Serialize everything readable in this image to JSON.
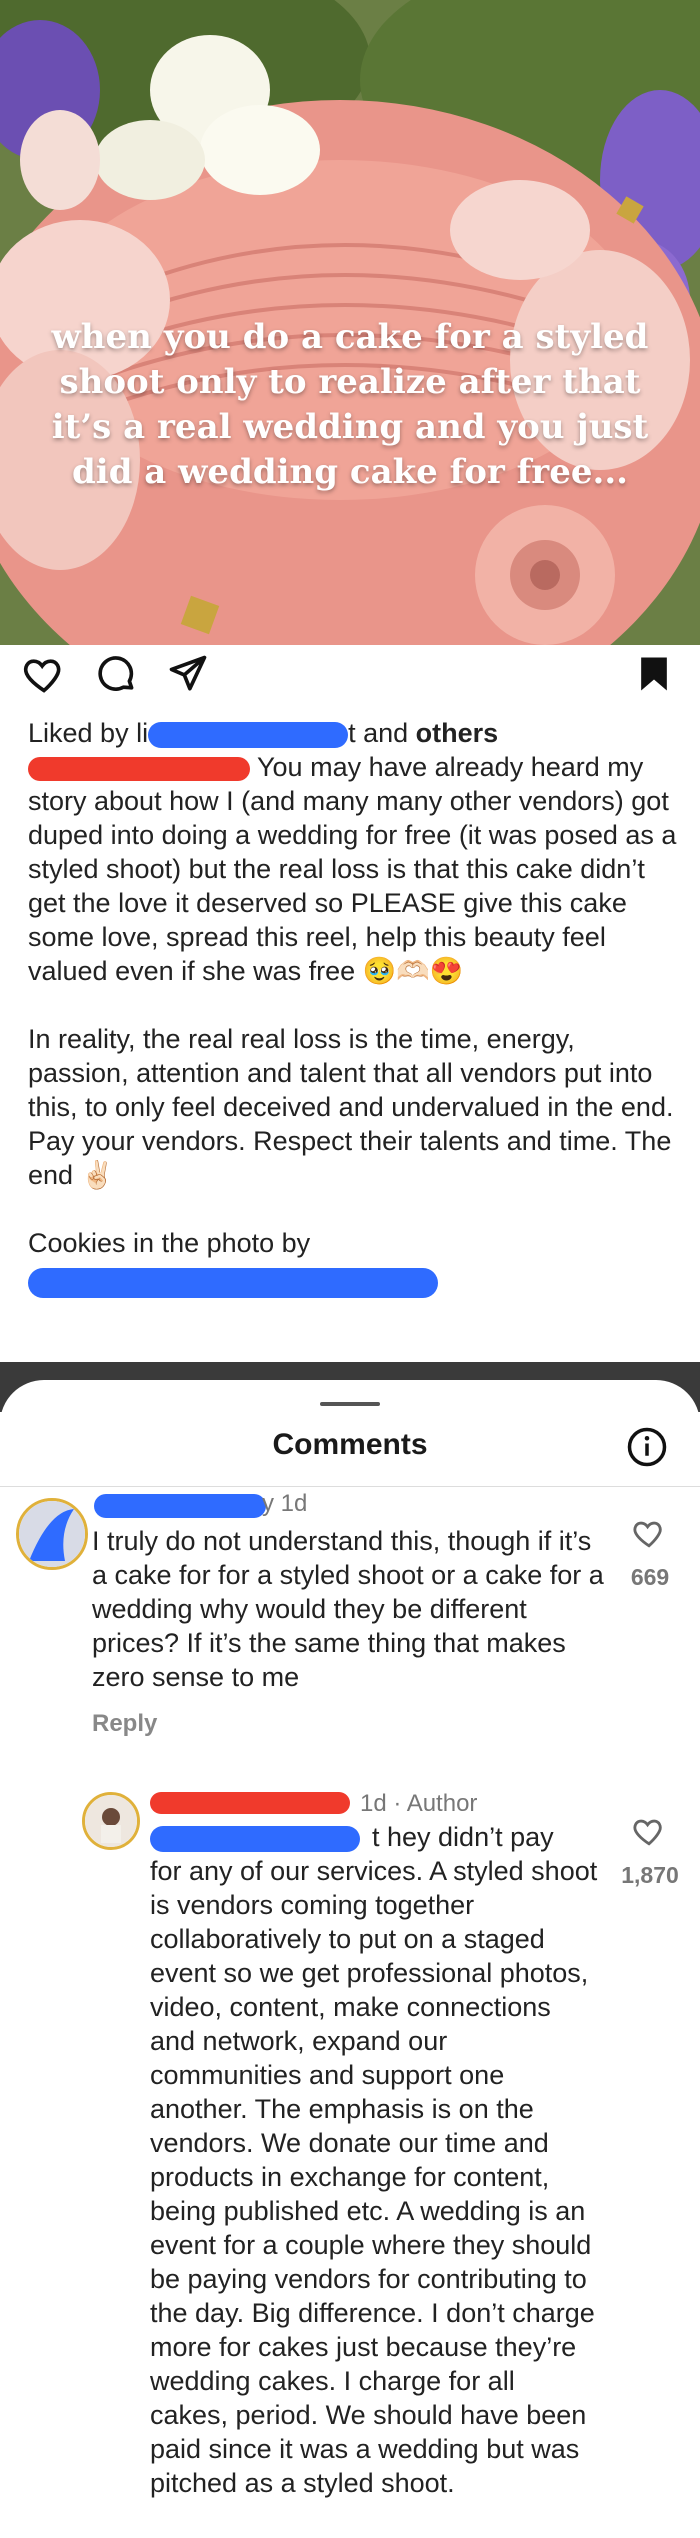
{
  "post": {
    "overlay_text": "when you do a cake for a styled shoot only to realize after that it’s a real wedding and you just did a wedding cake for free...",
    "liked_prefix": "Liked by li",
    "liked_middle": "t and ",
    "liked_others": "others",
    "caption_1": " You may have already heard my story about how I (and many many other vendors) got duped into doing a wedding for free (it was posed as a styled shoot) but the real loss is that this cake didn’t get the love it deserved so PLEASE give this cake some love, spread this reel, help this beauty feel valued even if she was free 🥹🫶🏻😍",
    "caption_2": "In reality, the real real loss is the time, energy, passion, attention and talent that all vendors put into this, to only feel deceived and undervalued in the end. Pay your vendors. Respect their talents and time. The end ✌🏻",
    "caption_3": "Cookies in the photo by"
  },
  "comments_sheet": {
    "title": "Comments",
    "comments": [
      {
        "name_suffix": "y",
        "time": "1d",
        "text": "I truly do not understand this, though if it’s a cake for for a styled shoot or a cake for a wedding why would they be different prices? If it’s the same thing that makes zero sense to me",
        "likes": "669",
        "reply_label": "Reply"
      },
      {
        "time_author": "1d · Author",
        "text_lead": "t hey didn’t pay",
        "text": "for any of our services. A styled shoot is vendors coming together collaboratively to put on a staged event so we get professional photos, video, content, make connections and network, expand our communities and support one another. The emphasis is on the vendors. We donate our time and products in exchange for content, being published etc. A wedding is an event for a couple where they should be paying vendors for contributing to the day. Big difference. I don’t charge more for cakes just because they’re wedding cakes. I charge for all cakes, period. We should have been paid since it was a wedding but was pitched as a styled shoot.",
        "likes": "1,870"
      }
    ]
  },
  "colors": {
    "scribble_blue": "#2f6bff",
    "scribble_red": "#f03a2c",
    "sheet_shade": "#3a3a3a"
  },
  "icons": [
    "heart-icon",
    "comment-icon",
    "share-icon",
    "bookmark-icon",
    "info-icon",
    "like-heart-icon"
  ]
}
